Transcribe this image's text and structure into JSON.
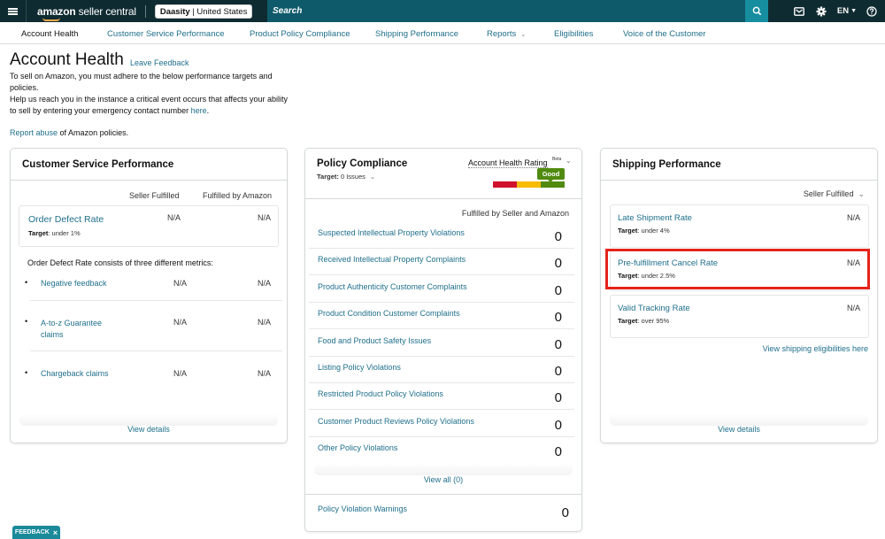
{
  "topbar": {
    "logo_main": "amazon",
    "logo_sub": " seller central",
    "store_name": "Daasity",
    "store_region": "United States",
    "search_placeholder": "Search",
    "language": "EN",
    "icons": [
      "menu-icon",
      "search-icon",
      "mail-icon",
      "gear-icon",
      "help-icon"
    ]
  },
  "nav": {
    "items": [
      {
        "label": "Account Health",
        "active": true
      },
      {
        "label": "Customer Service Performance"
      },
      {
        "label": "Product Policy Compliance"
      },
      {
        "label": "Shipping Performance"
      },
      {
        "label": "Reports"
      },
      {
        "label": "Eligibilities"
      },
      {
        "label": "Voice of the Customer"
      }
    ]
  },
  "header": {
    "title": "Account Health",
    "leave_feedback": "Leave Feedback",
    "intro_1": "To sell on Amazon, you must adhere to the below performance targets and policies.",
    "intro_2": "Help us reach you in the instance a critical event occurs that affects your ability to sell by entering your emergency contact number ",
    "intro_link": "here",
    "intro_end": ".",
    "report_link": "Report abuse",
    "report_rest": " of Amazon policies."
  },
  "customer_service": {
    "title": "Customer Service Performance",
    "col_seller": "Seller Fulfilled",
    "col_fba": "Fulfilled by Amazon",
    "odr": {
      "name": "Order Defect Rate",
      "target_label": "Target",
      "target": ": under 1%",
      "seller": "N/A",
      "fba": "N/A"
    },
    "consists": "Order Defect Rate consists of three different metrics:",
    "metrics": [
      {
        "name": "Negative feedback",
        "seller": "N/A",
        "fba": "N/A"
      },
      {
        "name": "A-to-z Guarantee claims",
        "seller": "N/A",
        "fba": "N/A"
      },
      {
        "name": "Chargeback claims",
        "seller": "N/A",
        "fba": "N/A"
      }
    ],
    "view_details": "View details"
  },
  "policy": {
    "title": "Policy Compliance",
    "target_label": "Target:",
    "target_value": " 0 Issues",
    "ahr_label": "Account Health Rating",
    "ahr_badge": "Beta",
    "ahr_status": "Good",
    "ahr_colors": {
      "bad": "#d0112b",
      "warn": "#f7bb00",
      "good": "#508a0f"
    },
    "col_head": "Fulfilled by Seller and Amazon",
    "rows": [
      {
        "label": "Suspected Intellectual Property Violations",
        "value": "0"
      },
      {
        "label": "Received Intellectual Property Complaints",
        "value": "0"
      },
      {
        "label": "Product Authenticity Customer Complaints",
        "value": "0"
      },
      {
        "label": "Product Condition Customer Complaints",
        "value": "0"
      },
      {
        "label": "Food and Product Safety Issues",
        "value": "0"
      },
      {
        "label": "Listing Policy Violations",
        "value": "0"
      },
      {
        "label": "Restricted Product Policy Violations",
        "value": "0"
      },
      {
        "label": "Customer Product Reviews Policy Violations",
        "value": "0"
      },
      {
        "label": "Other Policy Violations",
        "value": "0"
      }
    ],
    "view_all": "View all (0)",
    "warnings": {
      "label": "Policy Violation Warnings",
      "value": "0"
    }
  },
  "shipping": {
    "title": "Shipping Performance",
    "filter": "Seller Fulfilled",
    "metrics": [
      {
        "name": "Late Shipment Rate",
        "target_label": "Target",
        "target": ": under 4%",
        "value": "N/A"
      },
      {
        "name": "Pre-fulfillment Cancel Rate",
        "target_label": "Target",
        "target": ": under 2.5%",
        "value": "N/A",
        "highlighted": true
      },
      {
        "name": "Valid Tracking Rate",
        "target_label": "Target",
        "target": ": over 95%",
        "value": "N/A"
      }
    ],
    "eligibilities_link": "View shipping eligibilities here",
    "view_details": "View details"
  },
  "feedback_tab": {
    "label": "FEEDBACK",
    "close": "×"
  }
}
